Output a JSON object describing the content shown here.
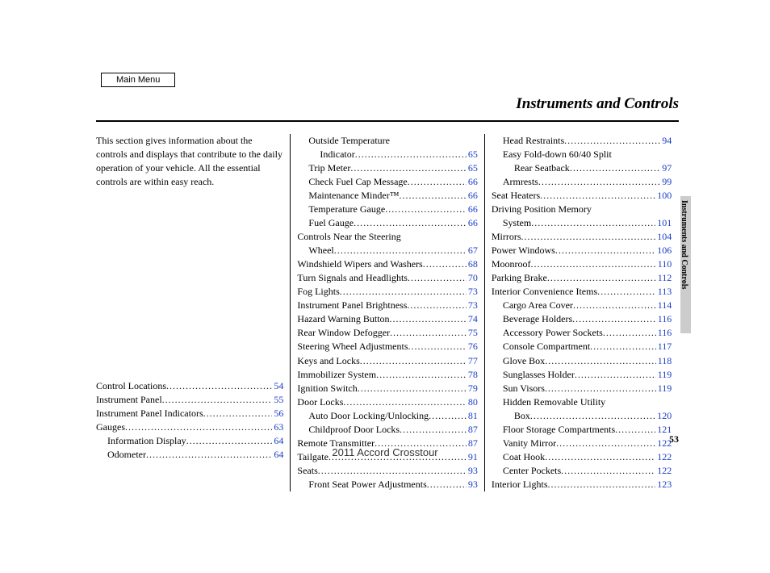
{
  "header": {
    "main_menu": "Main Menu"
  },
  "title": "Instruments and Controls",
  "side_tab": "Instruments and Controls",
  "page_number": "53",
  "vehicle": "2011 Accord Crosstour",
  "intro": "This section gives information about the controls and displays that contribute to the daily operation of your vehicle. All the essential controls are within easy reach.",
  "col1": [
    {
      "label": "Control Locations",
      "page": "54",
      "indent": 0
    },
    {
      "label": "Instrument Panel",
      "page": "55",
      "indent": 0
    },
    {
      "label": "Instrument Panel Indicators",
      "page": "56",
      "indent": 0
    },
    {
      "label": "Gauges",
      "page": "63",
      "indent": 0
    },
    {
      "label": "Information Display",
      "page": "64",
      "indent": 1
    },
    {
      "label": "Odometer",
      "page": "64",
      "indent": 1
    }
  ],
  "col2": [
    {
      "label": "Outside Temperature",
      "cont": true,
      "indent": 1
    },
    {
      "label": "Indicator",
      "page": "65",
      "indent": 2
    },
    {
      "label": "Trip Meter",
      "page": "65",
      "indent": 1
    },
    {
      "label": "Check Fuel Cap Message",
      "page": "66",
      "indent": 1
    },
    {
      "label": "Maintenance Minder™",
      "page": "66",
      "indent": 1
    },
    {
      "label": "Temperature Gauge",
      "page": "66",
      "indent": 1
    },
    {
      "label": "Fuel Gauge",
      "page": "66",
      "indent": 1
    },
    {
      "label": "Controls Near the Steering",
      "cont": true,
      "indent": 0
    },
    {
      "label": "Wheel",
      "page": "67",
      "indent": 1
    },
    {
      "label": "Windshield Wipers and Washers",
      "page": "68",
      "indent": 0
    },
    {
      "label": "Turn Signals and Headlights",
      "page": "70",
      "indent": 0
    },
    {
      "label": "Fog Lights",
      "page": "73",
      "indent": 0
    },
    {
      "label": "Instrument Panel Brightness",
      "page": "73",
      "indent": 0
    },
    {
      "label": "Hazard Warning Button",
      "page": "74",
      "indent": 0
    },
    {
      "label": "Rear Window Defogger",
      "page": "75",
      "indent": 0
    },
    {
      "label": "Steering Wheel Adjustments",
      "page": "76",
      "indent": 0
    },
    {
      "label": "Keys and Locks",
      "page": "77",
      "indent": 0
    },
    {
      "label": "Immobilizer System",
      "page": "78",
      "indent": 0
    },
    {
      "label": "Ignition Switch",
      "page": "79",
      "indent": 0
    },
    {
      "label": "Door Locks",
      "page": "80",
      "indent": 0
    },
    {
      "label": "Auto Door Locking/Unlocking",
      "page": "81",
      "indent": 1
    },
    {
      "label": "Childproof Door Locks",
      "page": "87",
      "indent": 1
    },
    {
      "label": "Remote Transmitter",
      "page": "87",
      "indent": 0
    },
    {
      "label": "Tailgate",
      "page": "91",
      "indent": 0
    },
    {
      "label": "Seats",
      "page": "93",
      "indent": 0
    },
    {
      "label": "Front Seat Power Adjustments",
      "page": "93",
      "indent": 1
    }
  ],
  "col3": [
    {
      "label": "Head Restraints",
      "page": "94",
      "indent": 1
    },
    {
      "label": "Easy Fold-down 60/40 Split",
      "cont": true,
      "indent": 1
    },
    {
      "label": "Rear Seatback",
      "page": "97",
      "indent": 2
    },
    {
      "label": "Armrests",
      "page": "99",
      "indent": 1
    },
    {
      "label": "Seat Heaters",
      "page": "100",
      "indent": 0
    },
    {
      "label": "Driving Position Memory",
      "cont": true,
      "indent": 0
    },
    {
      "label": "System",
      "page": "101",
      "indent": 1
    },
    {
      "label": "Mirrors",
      "page": "104",
      "indent": 0
    },
    {
      "label": "Power Windows",
      "page": "106",
      "indent": 0
    },
    {
      "label": "Moonroof",
      "page": "110",
      "indent": 0
    },
    {
      "label": "Parking Brake",
      "page": "112",
      "indent": 0
    },
    {
      "label": "Interior Convenience Items",
      "page": "113",
      "indent": 0
    },
    {
      "label": "Cargo Area Cover",
      "page": "114",
      "indent": 1
    },
    {
      "label": "Beverage Holders",
      "page": "116",
      "indent": 1
    },
    {
      "label": "Accessory Power Sockets",
      "page": "116",
      "indent": 1
    },
    {
      "label": "Console Compartment",
      "page": "117",
      "indent": 1
    },
    {
      "label": "Glove Box",
      "page": "118",
      "indent": 1
    },
    {
      "label": "Sunglasses Holder",
      "page": "119",
      "indent": 1
    },
    {
      "label": "Sun Visors",
      "page": "119",
      "indent": 1
    },
    {
      "label": "Hidden Removable Utility",
      "cont": true,
      "indent": 1
    },
    {
      "label": "Box",
      "page": "120",
      "indent": 2
    },
    {
      "label": "Floor Storage Compartments",
      "page": "121",
      "indent": 1
    },
    {
      "label": "Vanity Mirror",
      "page": "122",
      "indent": 1
    },
    {
      "label": "Coat Hook",
      "page": "122",
      "indent": 1
    },
    {
      "label": "Center Pockets",
      "page": "122",
      "indent": 1
    },
    {
      "label": "Interior Lights",
      "page": "123",
      "indent": 0
    }
  ]
}
